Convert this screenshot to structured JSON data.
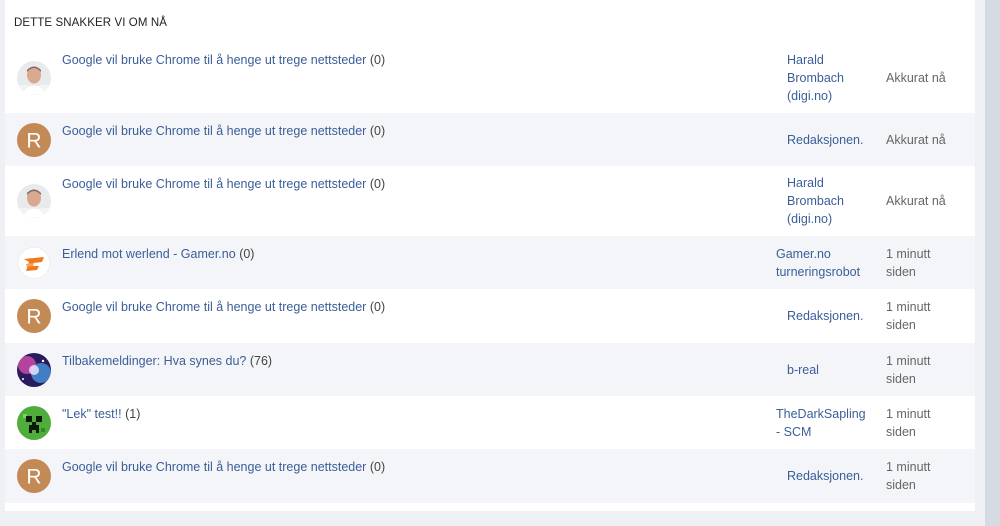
{
  "section": {
    "title": "DETTE SNAKKER VI OM NÅ"
  },
  "rows": [
    {
      "title": "Google vil bruke Chrome til å henge ut trege nettsteder",
      "count": "(0)",
      "author": [
        "Harald",
        "Brombach",
        "(digi.no)"
      ],
      "time": [
        "Akkurat nå"
      ],
      "avatar": "person-photo"
    },
    {
      "title": "Google vil bruke Chrome til å henge ut trege nettsteder",
      "count": "(0)",
      "author": [
        "Redaksjonen."
      ],
      "time": [
        "Akkurat nå"
      ],
      "avatar": "letter-r",
      "letter": "R"
    },
    {
      "title": "Google vil bruke Chrome til å henge ut trege nettsteder",
      "count": "(0)",
      "author": [
        "Harald",
        "Brombach",
        "(digi.no)"
      ],
      "time": [
        "Akkurat nå"
      ],
      "avatar": "person-photo"
    },
    {
      "title": "Erlend mot werlend - Gamer.no",
      "count": "(0)",
      "author": [
        "Gamer.no",
        "turneringsrobot"
      ],
      "time": [
        "1 minutt",
        "siden"
      ],
      "avatar": "gamer-logo"
    },
    {
      "title": "Google vil bruke Chrome til å henge ut trege nettsteder",
      "count": "(0)",
      "author": [
        "Redaksjonen."
      ],
      "time": [
        "1 minutt",
        "siden"
      ],
      "avatar": "letter-r",
      "letter": "R"
    },
    {
      "title": "Tilbakemeldinger: Hva synes du?",
      "count": "(76)",
      "author": [
        "b-real"
      ],
      "time": [
        "1 minutt",
        "siden"
      ],
      "avatar": "galaxy"
    },
    {
      "title": "\"Lek\" test!!",
      "count": "(1)",
      "author": [
        "TheDarkSapling",
        "- SCM"
      ],
      "time": [
        "1 minutt",
        "siden"
      ],
      "avatar": "creeper"
    },
    {
      "title": "Google vil bruke Chrome til å henge ut trege nettsteder",
      "count": "(0)",
      "author": [
        "Redaksjonen."
      ],
      "time": [
        "1 minutt",
        "siden"
      ],
      "avatar": "letter-r",
      "letter": "R"
    }
  ],
  "colors": {
    "link": "#3b5e99",
    "avatar_r": "#c48a55",
    "alt_row": "#f3f5f8",
    "page_bg": "#eef0f4"
  }
}
